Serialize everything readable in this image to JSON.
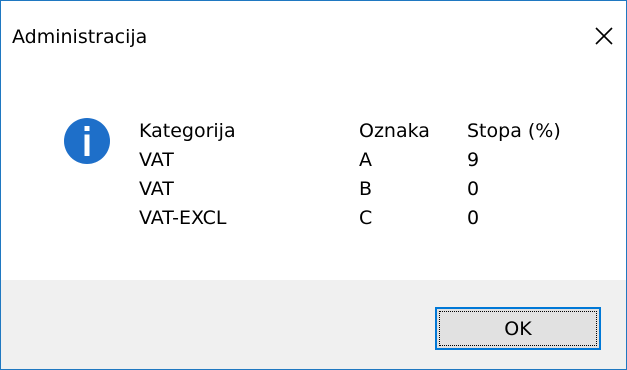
{
  "window": {
    "title": "Administracija"
  },
  "icons": {
    "info": "info-icon",
    "close": "close-icon",
    "accent_color": "#1e6fc9"
  },
  "table": {
    "headers": [
      "Kategorija",
      "Oznaka",
      "Stopa (%)"
    ],
    "rows": [
      [
        "VAT",
        "A",
        "9"
      ],
      [
        "VAT",
        "B",
        "0"
      ],
      [
        "VAT-EXCL",
        "C",
        "0"
      ]
    ]
  },
  "buttons": {
    "ok_label": "OK"
  }
}
